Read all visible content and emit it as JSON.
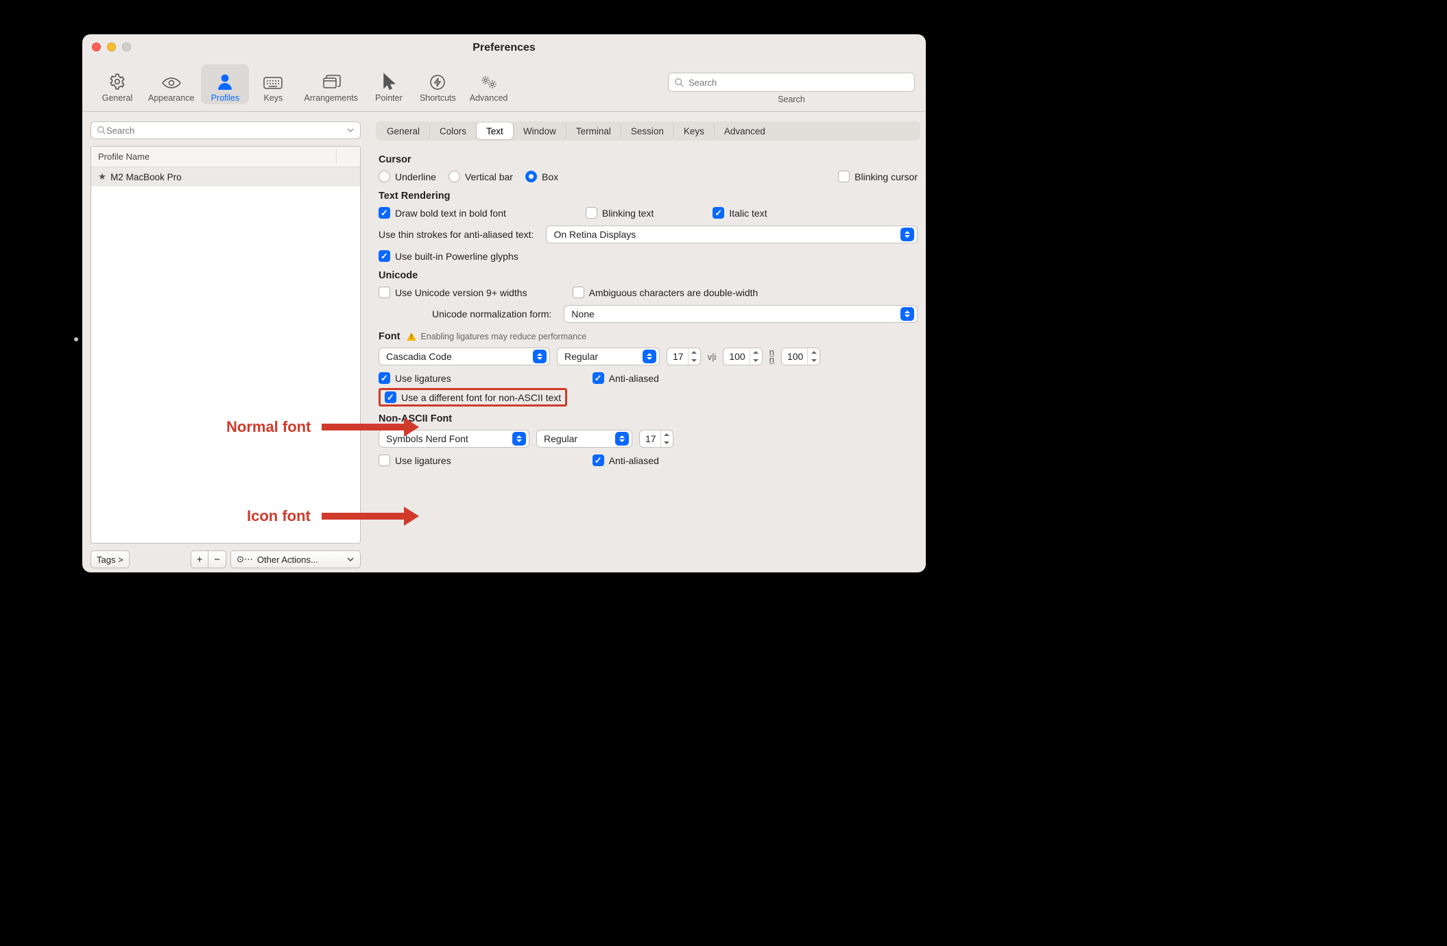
{
  "window": {
    "title": "Preferences"
  },
  "toolbar": {
    "items": [
      {
        "label": "General"
      },
      {
        "label": "Appearance"
      },
      {
        "label": "Profiles"
      },
      {
        "label": "Keys"
      },
      {
        "label": "Arrangements"
      },
      {
        "label": "Pointer"
      },
      {
        "label": "Shortcuts"
      },
      {
        "label": "Advanced"
      }
    ],
    "search_placeholder": "Search",
    "search_label": "Search"
  },
  "left": {
    "search_placeholder": "Search",
    "column_header": "Profile Name",
    "profiles": [
      "M2 MacBook Pro"
    ],
    "tags_button": "Tags >",
    "other_actions": "Other Actions..."
  },
  "segments": [
    "General",
    "Colors",
    "Text",
    "Window",
    "Terminal",
    "Session",
    "Keys",
    "Advanced"
  ],
  "segments_active": 2,
  "cursor": {
    "heading": "Cursor",
    "options": [
      "Underline",
      "Vertical bar",
      "Box"
    ],
    "selected": 2,
    "blinking": "Blinking cursor"
  },
  "textRendering": {
    "heading": "Text Rendering",
    "draw_bold": "Draw bold text in bold font",
    "blinking_text": "Blinking text",
    "italic_text": "Italic text",
    "thin_strokes_label": "Use thin strokes for anti-aliased text:",
    "thin_strokes_value": "On Retina Displays",
    "powerline": "Use built-in Powerline glyphs"
  },
  "unicode": {
    "heading": "Unicode",
    "v9": "Use Unicode version 9+ widths",
    "ambiguous": "Ambiguous characters are double-width",
    "norm_label": "Unicode normalization form:",
    "norm_value": "None"
  },
  "font": {
    "heading": "Font",
    "warning": "Enabling ligatures may reduce performance",
    "family": "Cascadia Code",
    "weight": "Regular",
    "size": "17",
    "hspacing": "100",
    "vspacing": "100",
    "use_ligatures": "Use ligatures",
    "anti_aliased": "Anti-aliased",
    "diff_nonascii": "Use a different font for non-ASCII text",
    "hlabel": "v|i",
    "vlabel_top": "n",
    "vlabel_bot": "n"
  },
  "nonascii": {
    "heading": "Non-ASCII Font",
    "family": "Symbols Nerd Font",
    "weight": "Regular",
    "size": "17",
    "use_ligatures": "Use ligatures",
    "anti_aliased": "Anti-aliased"
  },
  "annotations": {
    "normal": "Normal font",
    "icon": "Icon font"
  }
}
